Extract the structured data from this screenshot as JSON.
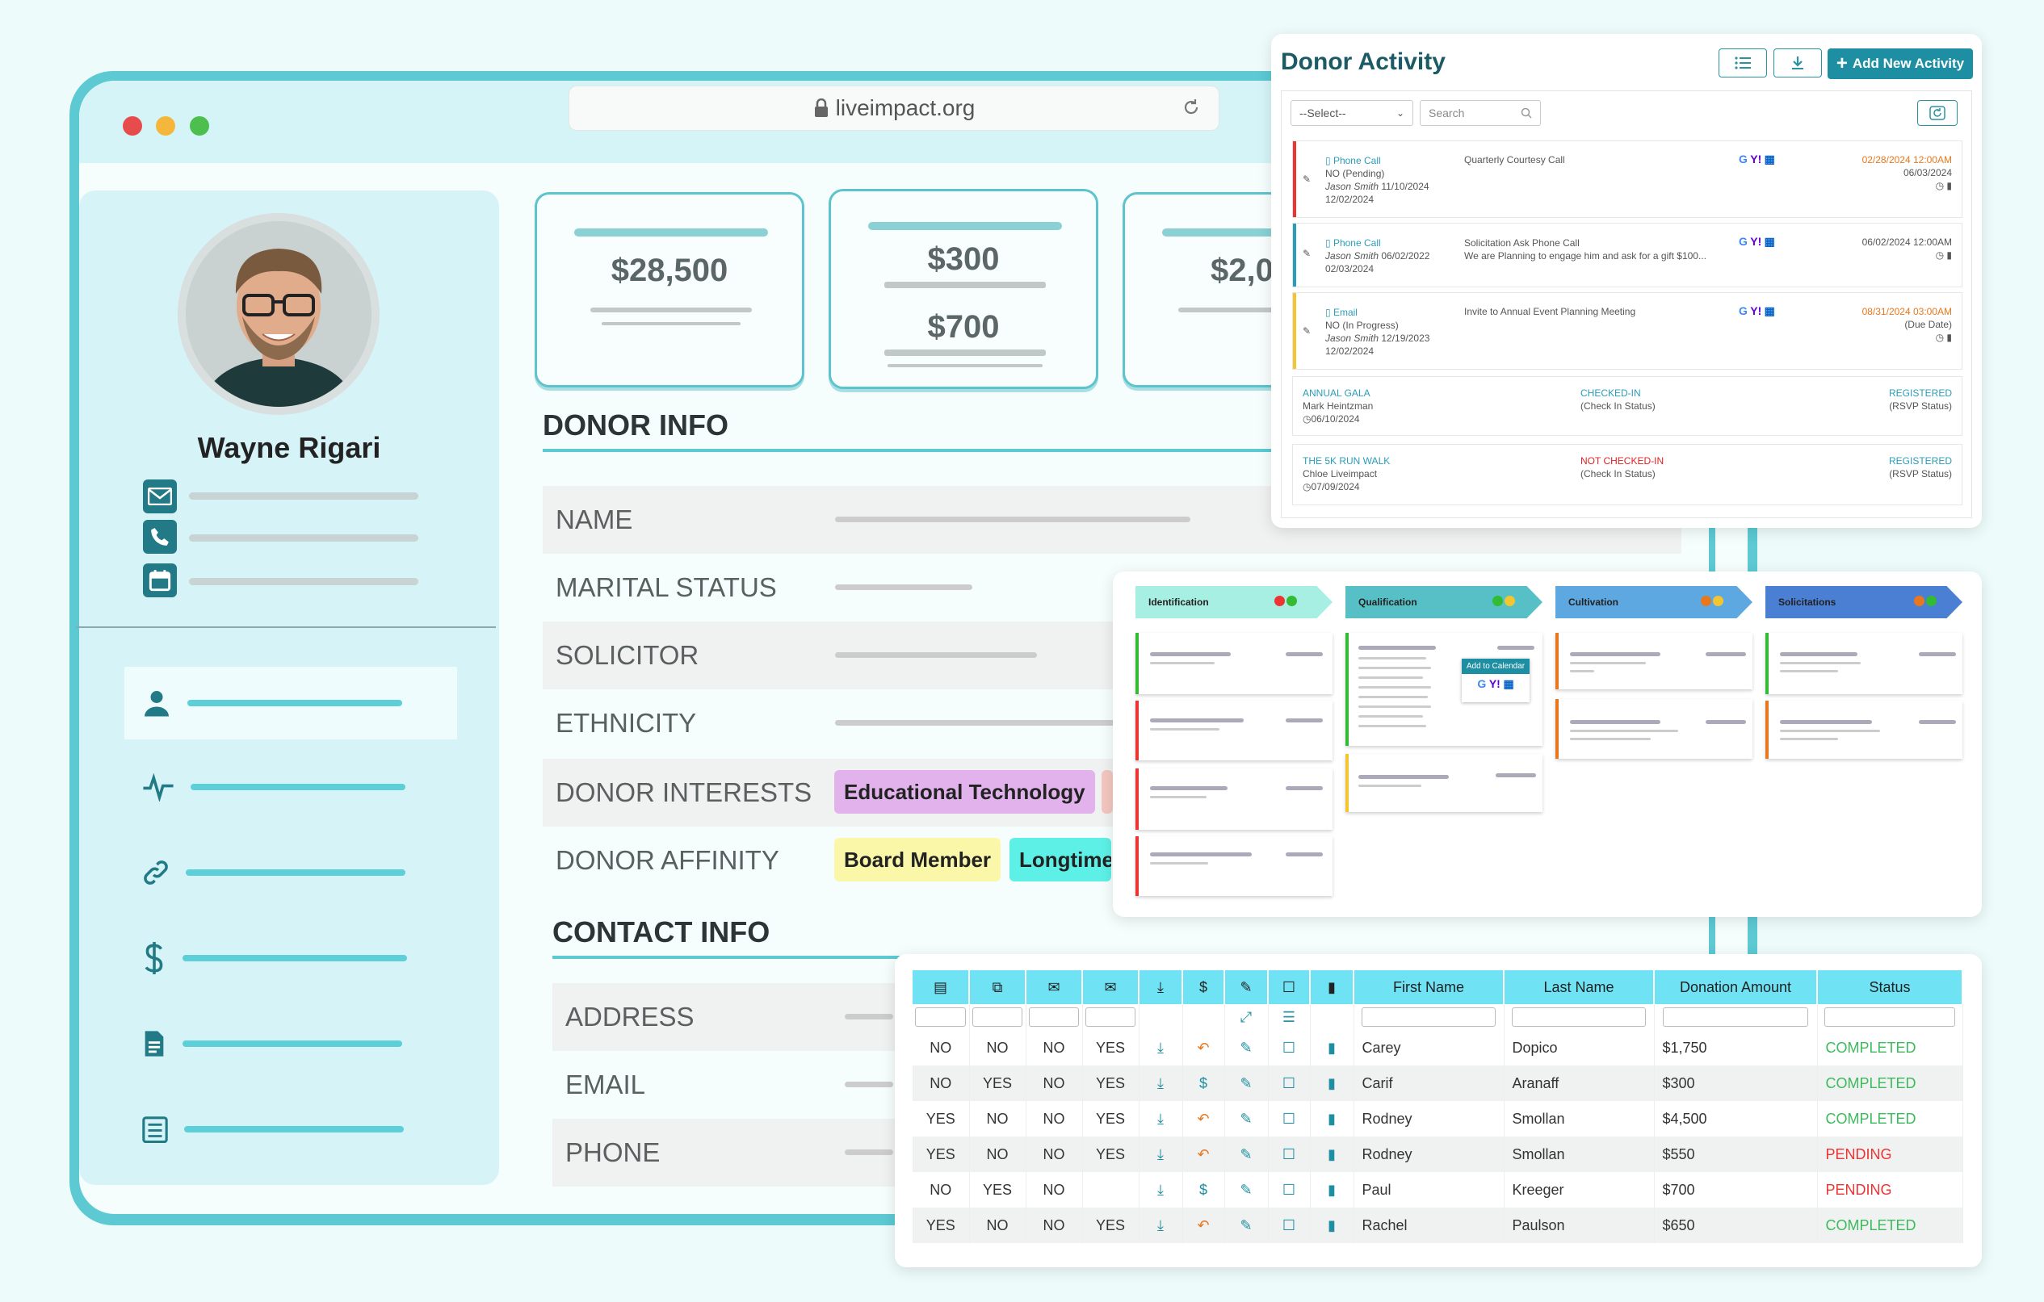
{
  "browser": {
    "url": "liveimpact.org",
    "dots": [
      "#e74c4c",
      "#f5b73b",
      "#4cbf4f"
    ]
  },
  "profile": {
    "name": "Wayne Rigari",
    "contact_icons": [
      "mail-icon",
      "phone-icon",
      "calendar-icon"
    ],
    "nav_icons": [
      "user-icon",
      "activity-pulse-icon",
      "link-icon",
      "dollar-icon",
      "document-icon",
      "checklist-icon"
    ]
  },
  "stats": {
    "card1": "$28,500",
    "card2_top": "$300",
    "card2_bottom": "$700",
    "card3": "$2,0"
  },
  "donor_info": {
    "title": "DONOR INFO",
    "rows": [
      "NAME",
      "MARITAL STATUS",
      "SOLICITOR",
      "ETHNICITY",
      "DONOR INTERESTS",
      "DONOR AFFINITY"
    ],
    "interests": [
      "Educational Technology"
    ],
    "affinity": [
      "Board Member",
      "Longtime"
    ]
  },
  "contact_info": {
    "title": "CONTACT INFO",
    "rows": [
      "ADDRESS",
      "EMAIL",
      "PHONE"
    ]
  },
  "activity": {
    "title": "Donor Activity",
    "add_label": "Add New Activity",
    "select_placeholder": "--Select--",
    "search_placeholder": "Search",
    "items": [
      {
        "type": "Phone Call",
        "status": "NO (Pending)",
        "person": "Jason Smith",
        "created": "11/10/2024",
        "date2": "12/02/2024",
        "subject": "Quarterly Courtesy Call",
        "note": "",
        "due": "02/28/2024 12:00AM",
        "due2": "06/03/2024",
        "color": "#e33"
      },
      {
        "type": "Phone Call",
        "status": "",
        "person": "Jason Smith",
        "created": "06/02/2022",
        "date2": "02/03/2024",
        "subject": "Solicitation Ask Phone Call",
        "note": "We are Planning to engage him and ask for a gift $100...",
        "due": "06/02/2024 12:00AM",
        "due2": "",
        "color": "#2a9db8"
      },
      {
        "type": "Email",
        "status": "NO (In Progress)",
        "person": "Jason Smith",
        "created": "12/19/2023",
        "date2": "12/02/2024",
        "subject": "Invite to Annual Event Planning  Meeting",
        "note": "",
        "due": "08/31/2024 03:00AM",
        "due2": "(Due Date)",
        "color": "#f2c531"
      }
    ],
    "events": [
      {
        "name": "ANNUAL GALA",
        "person": "Mark Heintzman",
        "date": "06/10/2024",
        "checkin": "CHECKED-IN",
        "checkin_label": "(Check In Status)",
        "rsvp": "REGISTERED",
        "rsvp_label": "(RSVP Status)"
      },
      {
        "name": "THE 5K RUN WALK",
        "person": "Chloe Liveimpact",
        "date": "07/09/2024",
        "checkin": "NOT CHECKED-IN",
        "checkin_label": "(Check In Status)",
        "rsvp": "REGISTERED",
        "rsvp_label": "(RSVP Status)"
      }
    ]
  },
  "pipeline": {
    "stages": [
      {
        "name": "Identification",
        "color": "#a8efe3"
      },
      {
        "name": "Qualification",
        "color": "#57c0c6"
      },
      {
        "name": "Cultivation",
        "color": "#5da8e0"
      },
      {
        "name": "Solicitations",
        "color": "#4a7fd3"
      }
    ],
    "add_to_calendar": "Add to Calendar"
  },
  "donations": {
    "columns": [
      "First Name",
      "Last Name",
      "Donation Amount",
      "Status"
    ],
    "rows": [
      {
        "c1": "NO",
        "c2": "NO",
        "c3": "NO",
        "c4": "YES",
        "action": "undo",
        "first": "Carey",
        "last": "Dopico",
        "amount": "$1,750",
        "status": "COMPLETED"
      },
      {
        "c1": "NO",
        "c2": "YES",
        "c3": "NO",
        "c4": "YES",
        "action": "dollar",
        "first": "Carif",
        "last": "Aranaff",
        "amount": "$300",
        "status": "COMPLETED"
      },
      {
        "c1": "YES",
        "c2": "NO",
        "c3": "NO",
        "c4": "YES",
        "action": "undo",
        "first": "Rodney",
        "last": "Smollan",
        "amount": "$4,500",
        "status": "COMPLETED"
      },
      {
        "c1": "YES",
        "c2": "NO",
        "c3": "NO",
        "c4": "YES",
        "action": "undo",
        "first": "Rodney",
        "last": "Smollan",
        "amount": "$550",
        "status": "PENDING"
      },
      {
        "c1": "NO",
        "c2": "YES",
        "c3": "NO",
        "c4": "",
        "action": "dollar",
        "first": "Paul",
        "last": "Kreeger",
        "amount": "$700",
        "status": "PENDING"
      },
      {
        "c1": "YES",
        "c2": "NO",
        "c3": "NO",
        "c4": "YES",
        "action": "undo",
        "first": "Rachel",
        "last": "Paulson",
        "amount": "$650",
        "status": "COMPLETED"
      }
    ]
  }
}
